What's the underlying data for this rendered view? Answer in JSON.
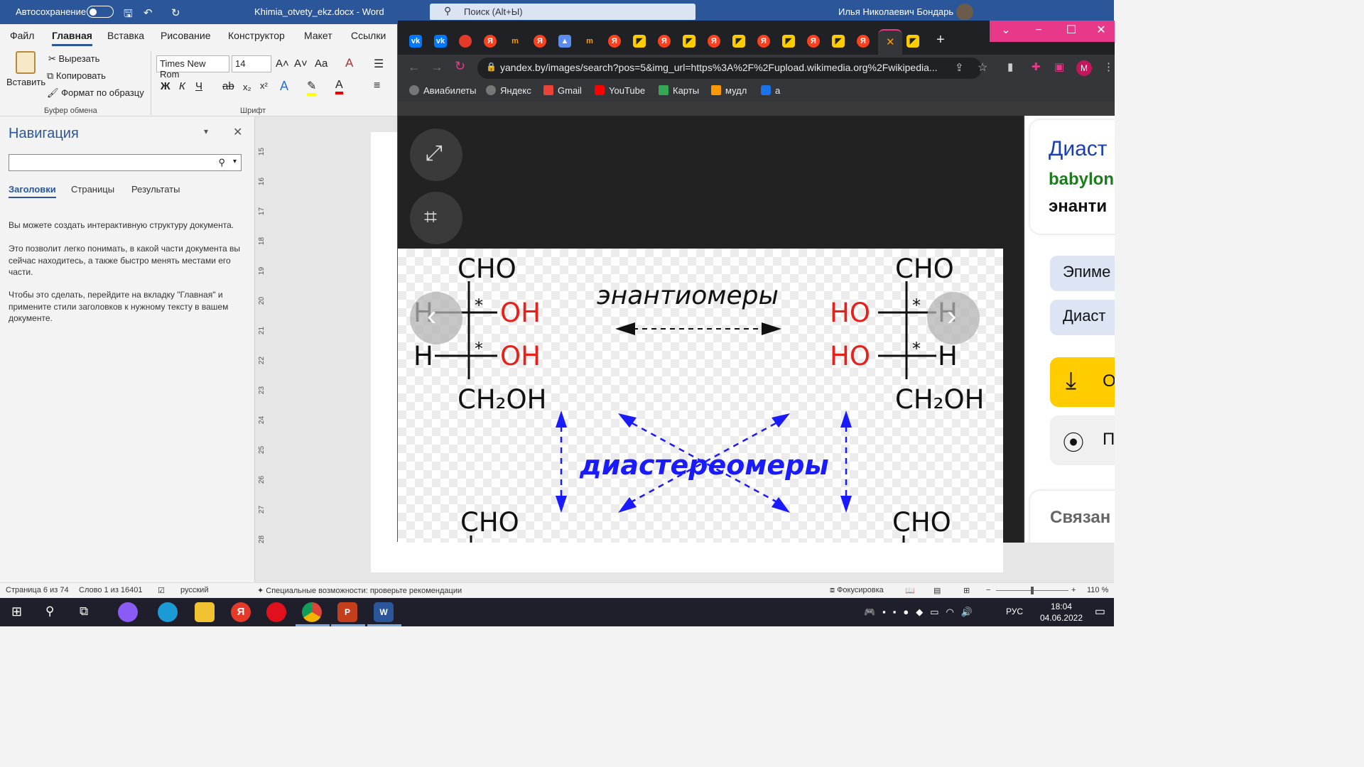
{
  "word": {
    "autosave_label": "Автосохранение",
    "doc_title": "Khimia_otvety_ekz.docx - Word",
    "search_placeholder": "Поиск (Alt+Ы)",
    "user_name": "Илья Николаевич Бондарь",
    "tabs": [
      "Файл",
      "Главная",
      "Вставка",
      "Рисование",
      "Конструктор",
      "Макет",
      "Ссылки"
    ],
    "clipboard": {
      "paste": "Вставить",
      "cut": "Вырезать",
      "copy": "Копировать",
      "format_painter": "Формат по образцу",
      "group": "Буфер обмена"
    },
    "font": {
      "name": "Times New Rom",
      "size": "14",
      "group": "Шрифт"
    },
    "nav": {
      "title": "Навигация",
      "tabs": [
        "Заголовки",
        "Страницы",
        "Результаты"
      ],
      "p1": "Вы можете создать интерактивную структуру документа.",
      "p2": "Это позволит легко понимать, в какой части документа вы сейчас находитесь, а также быстро менять местами его части.",
      "p3": "Чтобы это сделать, перейдите на вкладку \"Главная\" и примените стили заголовков к нужному тексту в вашем документе."
    },
    "ruler_numbers": [
      "15",
      "16",
      "17",
      "18",
      "19",
      "20",
      "21",
      "22",
      "23",
      "24",
      "25",
      "26",
      "27",
      "28"
    ],
    "status": {
      "page": "Страница 6 из 74",
      "words": "Слово 1 из 16401",
      "lang": "русский",
      "accessibility": "Специальные возможности: проверьте рекомендации",
      "focus": "Фокусировка",
      "zoom": "110 %"
    }
  },
  "chrome": {
    "url": "yandex.by/images/search?pos=5&img_url=https%3A%2F%2Fupload.wikimedia.org%2Fwikipedia...",
    "bookmarks": [
      "Авиабилеты",
      "Яндекс",
      "Gmail",
      "YouTube",
      "Карты",
      "мудл",
      "а"
    ],
    "profile_letter": "M",
    "side": {
      "title": "Диаст",
      "subtitle": "babylon",
      "line3": "энанти",
      "pill1": "Эпиме",
      "pill2": "Диаст",
      "btn_open": "О",
      "btn_lens": "П",
      "related": "Связан"
    },
    "image": {
      "top_left": "CHO",
      "top_right": "CHO",
      "h": "H",
      "oh": "OH",
      "ho": "HO",
      "star": "*",
      "ch2oh": "CH₂OH",
      "enantiomers": "энантиомеры",
      "diastereomers": "диастереомеры",
      "bottom_left": "CHO",
      "bottom_right": "CHO"
    }
  },
  "taskbar": {
    "lang": "РУС",
    "time": "18:04",
    "date": "04.06.2022"
  },
  "colors": {
    "word_blue": "#2b579a",
    "red": "#e8201c",
    "blue_label": "#1a1aff",
    "chrome_dark": "#202124"
  }
}
